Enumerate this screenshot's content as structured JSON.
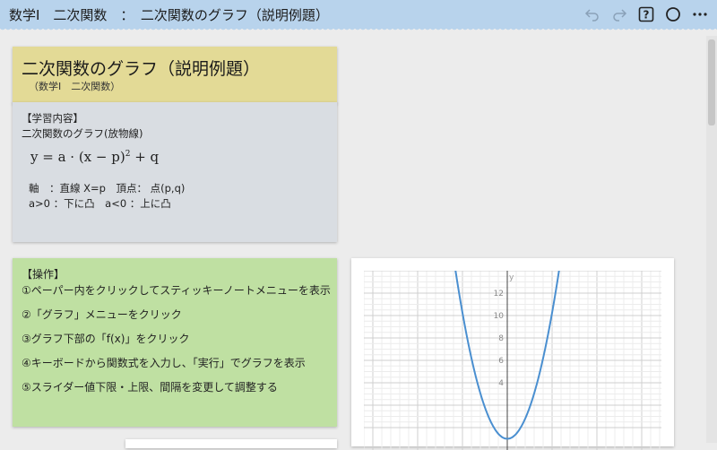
{
  "header": {
    "title": "数学Ⅰ　二次関数　：　二次関数のグラフ（説明例題）",
    "icons": [
      "undo-icon",
      "redo-icon",
      "help-icon",
      "circle-icon",
      "more-icon"
    ]
  },
  "title_note": {
    "title": "二次関数のグラフ（説明例題）",
    "subtitle": "（数学Ⅰ　二次関数）"
  },
  "content_note": {
    "heading": "【学習内容】",
    "line1": "二次関数のグラフ(放物線)",
    "formula_main": "y = a · (x − p)",
    "formula_exp": "2",
    "formula_tail": " + q",
    "line2": "軸　：直線 X=p　頂点：  点(p,q)",
    "line3": "a>0 ：下に凸　a<0 ：上に凸"
  },
  "ops_note": {
    "heading": "【操作】",
    "steps": [
      "①ペーパー内をクリックしてスティッキーノートメニューを表示",
      "②「グラフ」メニューをクリック",
      "③グラフ下部の「f(x)」をクリック",
      "④キーボードから関数式を入力し、「実行」でグラフを表示",
      "⑤スライダー値下限・上限、間隔を変更して調整する"
    ]
  },
  "graph": {
    "y_axis_label": "y",
    "y_ticks": [
      "12",
      "10",
      "8",
      "6",
      "4"
    ]
  },
  "chart_data": {
    "type": "line",
    "function": "y = a(x-p)^2 + q",
    "visible_y_range": [
      1,
      14
    ],
    "y_ticks": [
      4,
      6,
      8,
      10,
      12
    ],
    "ylabel": "y",
    "grid": true,
    "series": [
      {
        "color": "#4a8fd0"
      }
    ]
  },
  "colors": {
    "header": "#b8d3ec",
    "title_note": "#e3da96",
    "content_note": "#d9dde2",
    "ops_note": "#bfe0a2",
    "curve": "#4a8fd0"
  }
}
